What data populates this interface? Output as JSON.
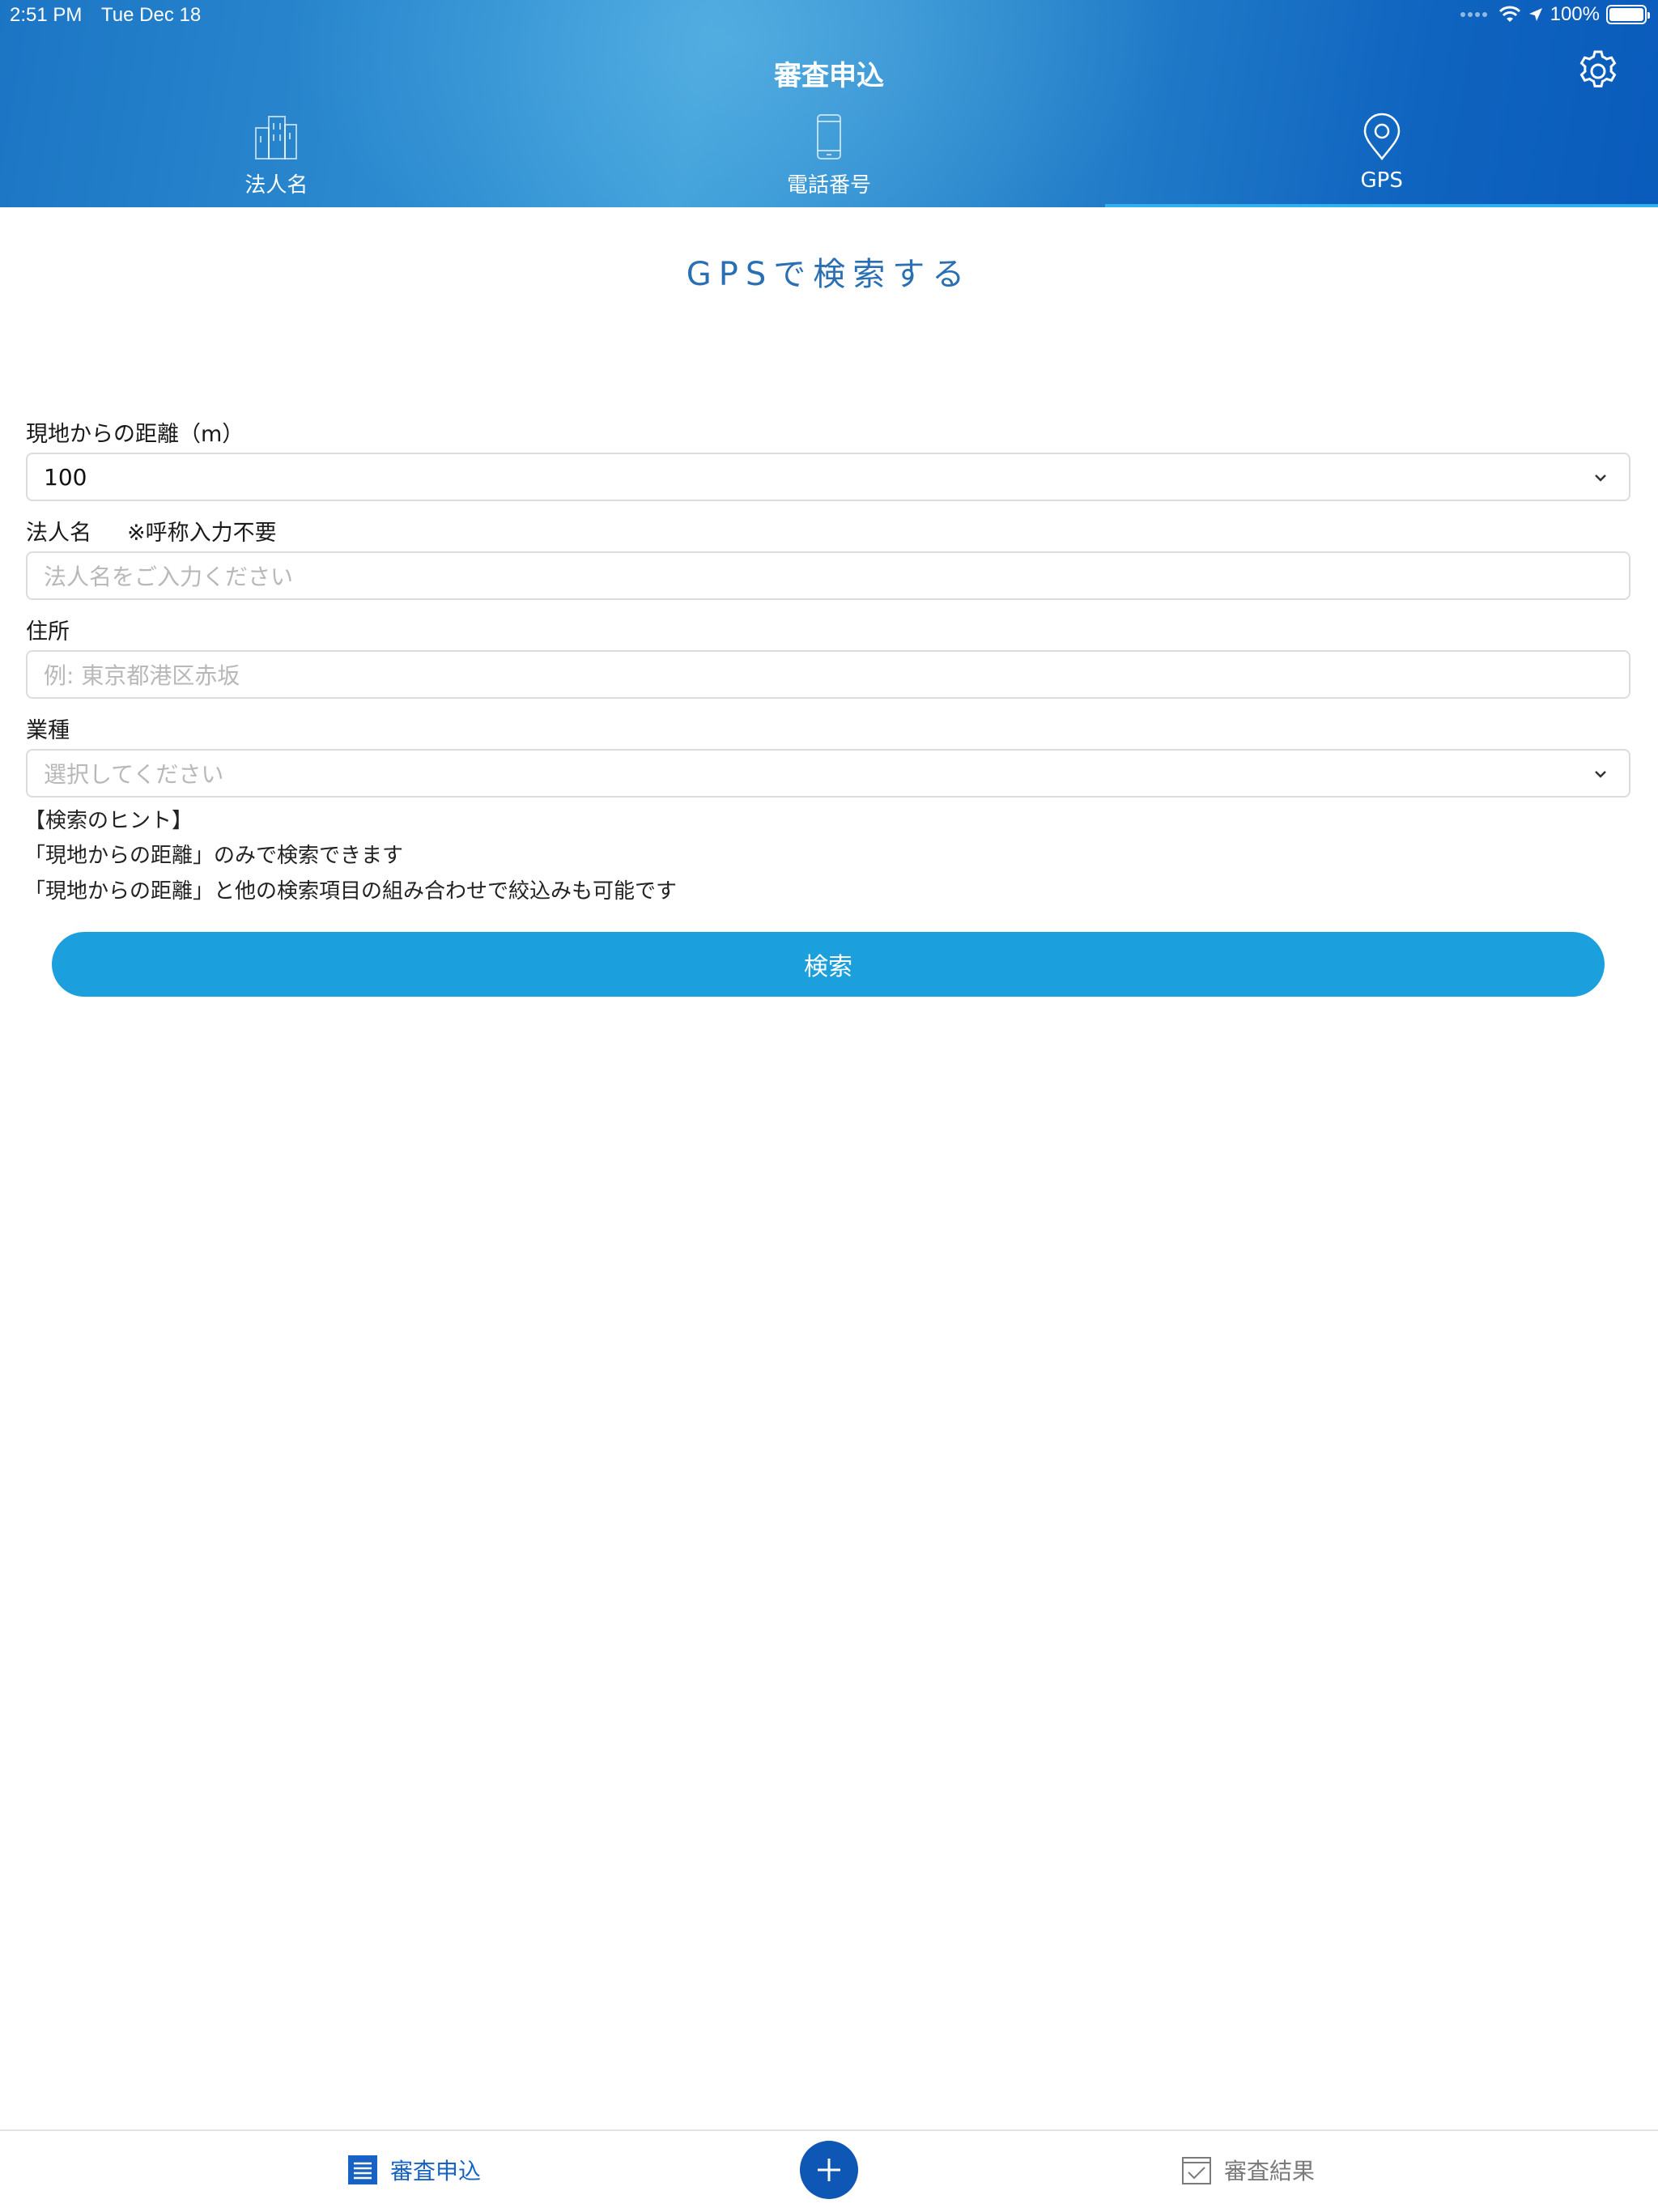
{
  "status_bar": {
    "time": "2:51 PM",
    "date": "Tue Dec 18",
    "battery": "100%"
  },
  "header": {
    "title": "審査申込",
    "tabs": [
      {
        "label": "法人名",
        "icon": "building-icon",
        "active": false
      },
      {
        "label": "電話番号",
        "icon": "tablet-icon",
        "active": false
      },
      {
        "label": "GPS",
        "icon": "location-pin-icon",
        "active": true
      }
    ]
  },
  "main": {
    "section_title": "GPSで検索する",
    "distance": {
      "label": "現地からの距離（m）",
      "value": "100"
    },
    "company": {
      "label": "法人名",
      "note": "※呼称入力不要",
      "placeholder": "法人名をご入力ください"
    },
    "address": {
      "label": "住所",
      "placeholder": "例: 東京都港区赤坂"
    },
    "industry": {
      "label": "業種",
      "placeholder": "選択してください"
    },
    "hints": [
      "【検索のヒント】",
      "「現地からの距離」のみで検索できます",
      "「現地からの距離」と他の検索項目の組み合わせで絞込みも可能です"
    ],
    "search_label": "検索"
  },
  "bottom_bar": {
    "apply_label": "審査申込",
    "results_label": "審査結果"
  },
  "colors": {
    "accent": "#1ba0dd",
    "primary": "#0e57b5",
    "title_blue": "#2a6fb3",
    "active_tab_underline": "#2fb1f0"
  }
}
